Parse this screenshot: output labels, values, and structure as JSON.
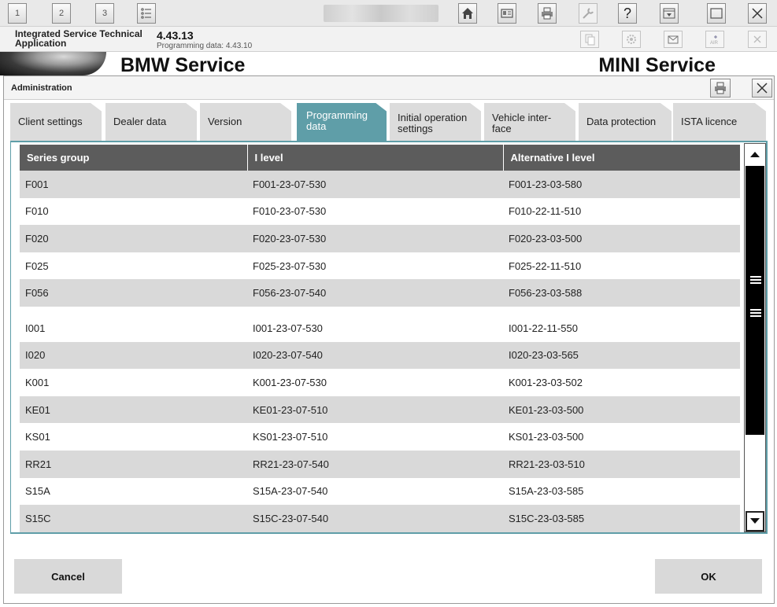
{
  "toolbar": {
    "tab_buttons": [
      "1",
      "2",
      "3"
    ]
  },
  "app": {
    "name_line1": "Integrated Service Technical",
    "name_line2": "Application",
    "version": "4.43.13",
    "programming_data": "Programming data:  4.43.10"
  },
  "brand": {
    "left": "BMW Service",
    "right": "MINI Service"
  },
  "dialog": {
    "title": "Administration",
    "tabs": [
      {
        "label": "Client settings",
        "active": false
      },
      {
        "label": "Dealer data",
        "active": false
      },
      {
        "label": "Version",
        "active": false
      },
      {
        "label": "Programming data",
        "active": true
      },
      {
        "label": "Initial operation settings",
        "active": false
      },
      {
        "label": "Vehicle inter-face",
        "active": false
      },
      {
        "label": "Data protection",
        "active": false
      },
      {
        "label": "ISTA licence",
        "active": false
      }
    ],
    "table": {
      "headers": [
        "Series group",
        "I level",
        "Alternative I level"
      ],
      "rows": [
        [
          "F001",
          "F001-23-07-530",
          "F001-23-03-580"
        ],
        [
          "F010",
          "F010-23-07-530",
          "F010-22-11-510"
        ],
        [
          "F020",
          "F020-23-07-530",
          "F020-23-03-500"
        ],
        [
          "F025",
          "F025-23-07-530",
          "F025-22-11-510"
        ],
        [
          "F056",
          "F056-23-07-540",
          "F056-23-03-588"
        ],
        [
          "I001",
          "I001-23-07-530",
          "I001-22-11-550"
        ],
        [
          "I020",
          "I020-23-07-540",
          "I020-23-03-565"
        ],
        [
          "K001",
          "K001-23-07-530",
          "K001-23-03-502"
        ],
        [
          "KE01",
          "KE01-23-07-510",
          "KE01-23-03-500"
        ],
        [
          "KS01",
          "KS01-23-07-510",
          "KS01-23-03-500"
        ],
        [
          "RR21",
          "RR21-23-07-540",
          "RR21-23-03-510"
        ],
        [
          "S15A",
          "S15A-23-07-540",
          "S15A-23-03-585"
        ],
        [
          "S15C",
          "S15C-23-07-540",
          "S15C-23-03-585"
        ]
      ]
    },
    "cancel_label": "Cancel",
    "ok_label": "OK"
  },
  "colors": {
    "accent_teal": "#5f9ea8",
    "header_gray": "#5c5c5c",
    "row_gray": "#d9d9d9"
  }
}
